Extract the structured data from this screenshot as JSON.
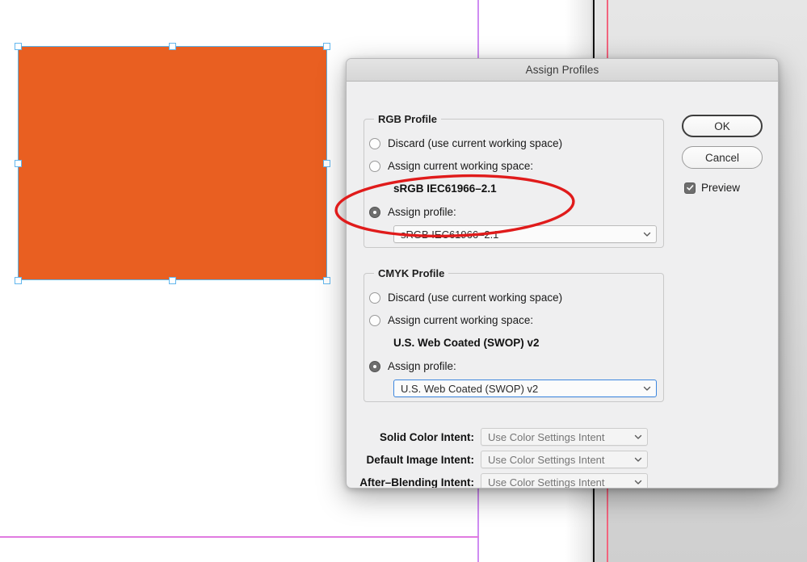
{
  "canvas": {
    "artwork_fill_color": "#e95f21",
    "selection_color": "#63b7ee",
    "guide_color": "#cf8cf2",
    "bleed_color": "#f2647e",
    "page_edge_color": "#111111"
  },
  "dialog": {
    "title": "Assign Profiles",
    "rgb": {
      "group_title": "RGB Profile",
      "option_discard": "Discard (use current working space)",
      "option_working_space": "Assign current working space:",
      "working_space_value": "sRGB IEC61966–2.1",
      "option_assign_profile": "Assign profile:",
      "assign_profile_value": "sRGB IEC61966–2.1",
      "selected": "assign_profile"
    },
    "cmyk": {
      "group_title": "CMYK Profile",
      "option_discard": "Discard (use current working space)",
      "option_working_space": "Assign current working space:",
      "working_space_value": "U.S. Web Coated (SWOP) v2",
      "option_assign_profile": "Assign profile:",
      "assign_profile_value": "U.S. Web Coated (SWOP) v2",
      "selected": "assign_profile"
    },
    "intents": [
      {
        "label": "Solid Color Intent:",
        "value": "Use Color Settings Intent"
      },
      {
        "label": "Default Image Intent:",
        "value": "Use Color Settings Intent"
      },
      {
        "label": "After–Blending Intent:",
        "value": "Use Color Settings Intent"
      }
    ],
    "buttons": {
      "ok": "OK",
      "cancel": "Cancel"
    },
    "preview": {
      "label": "Preview",
      "checked": true
    }
  },
  "annotation": {
    "shape": "ellipse",
    "color": "#e01b1b",
    "targets": "Assign profile: sRGB IEC61966–2.1"
  }
}
